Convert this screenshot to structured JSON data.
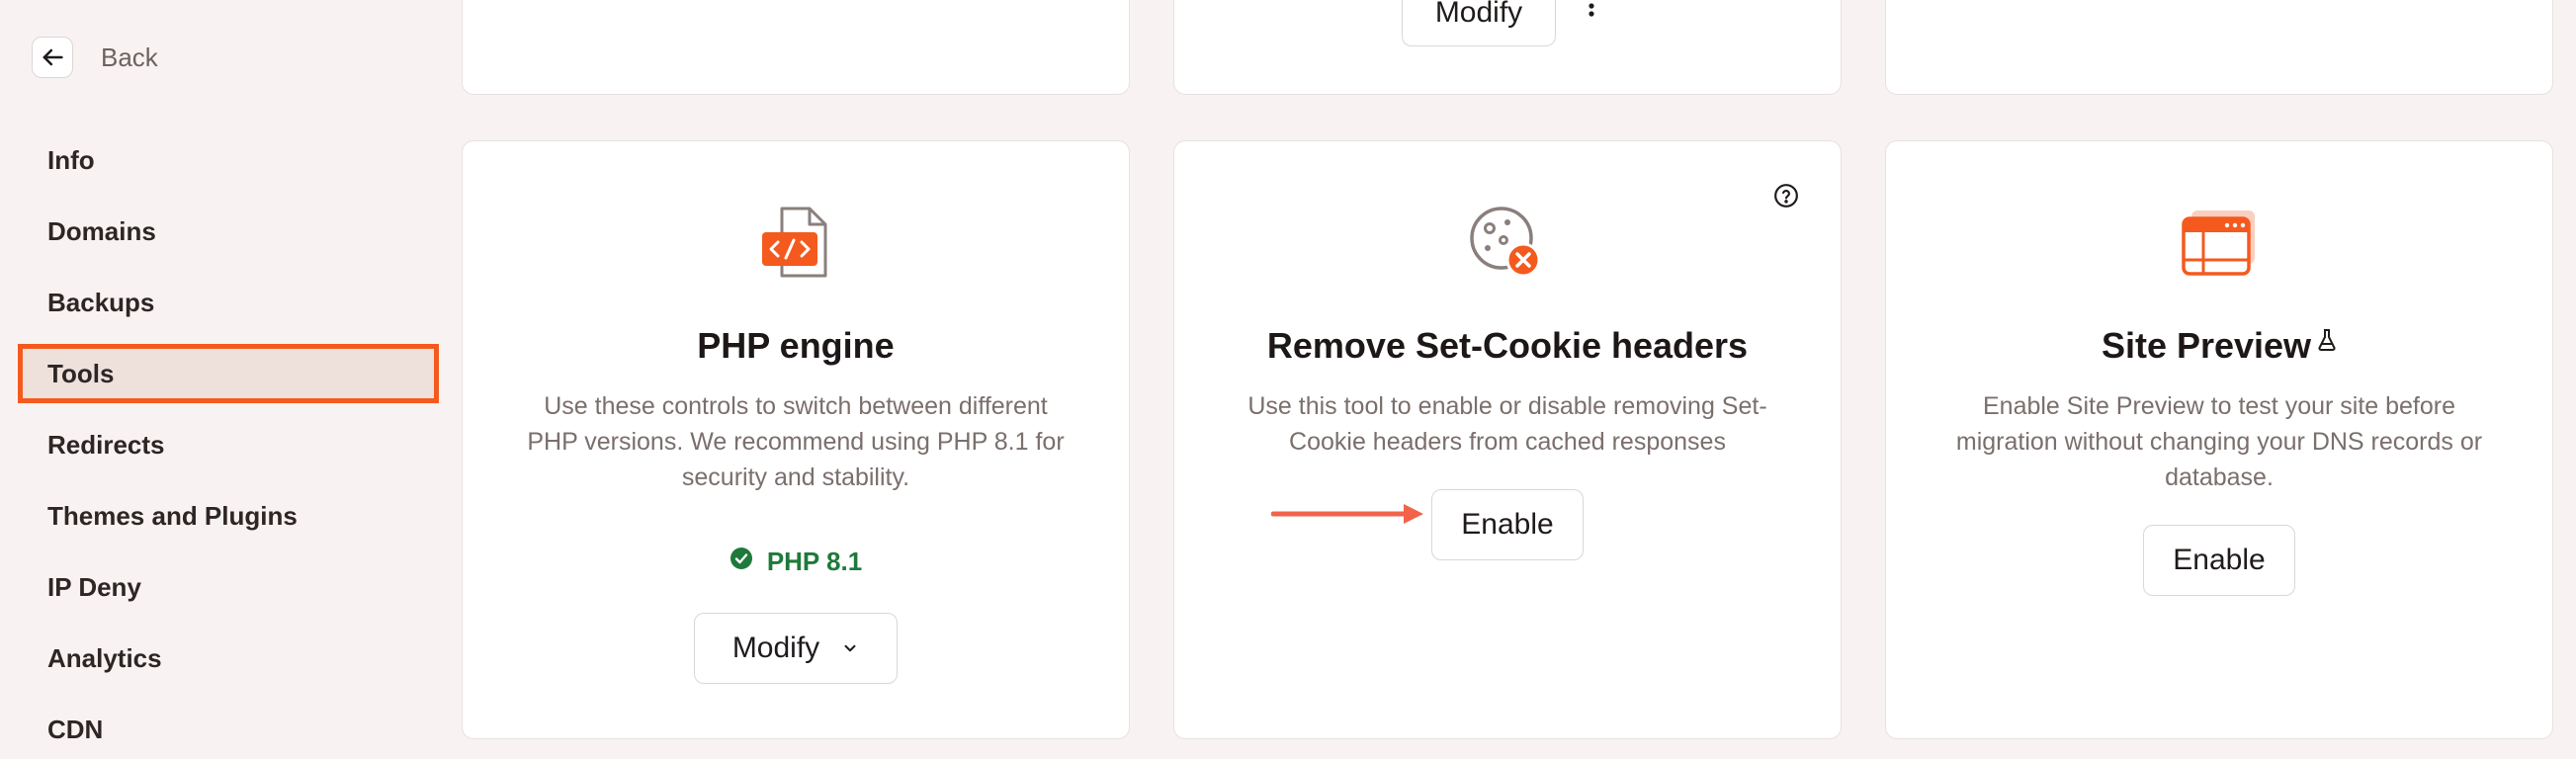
{
  "sidebar": {
    "back_label": "Back",
    "items": [
      {
        "label": "Info"
      },
      {
        "label": "Domains"
      },
      {
        "label": "Backups"
      },
      {
        "label": "Tools",
        "active": true
      },
      {
        "label": "Redirects"
      },
      {
        "label": "Themes and Plugins"
      },
      {
        "label": "IP Deny"
      },
      {
        "label": "Analytics"
      },
      {
        "label": "CDN"
      }
    ]
  },
  "top_row": {
    "middle_button_label": "Modify"
  },
  "cards": {
    "php": {
      "title": "PHP engine",
      "description": "Use these controls to switch between different PHP versions. We recommend using PHP 8.1 for security and stability.",
      "status": "PHP 8.1",
      "button_label": "Modify"
    },
    "cookie": {
      "title": "Remove Set-Cookie headers",
      "description": "Use this tool to enable or disable removing Set-Cookie headers from cached responses",
      "button_label": "Enable"
    },
    "preview": {
      "title": "Site Preview",
      "description": "Enable Site Preview to test your site before migration without changing your DNS records or database.",
      "button_label": "Enable"
    }
  },
  "colors": {
    "accent": "#f45a1e",
    "success": "#1e7a3a",
    "annotation_arrow": "#f2634a"
  }
}
